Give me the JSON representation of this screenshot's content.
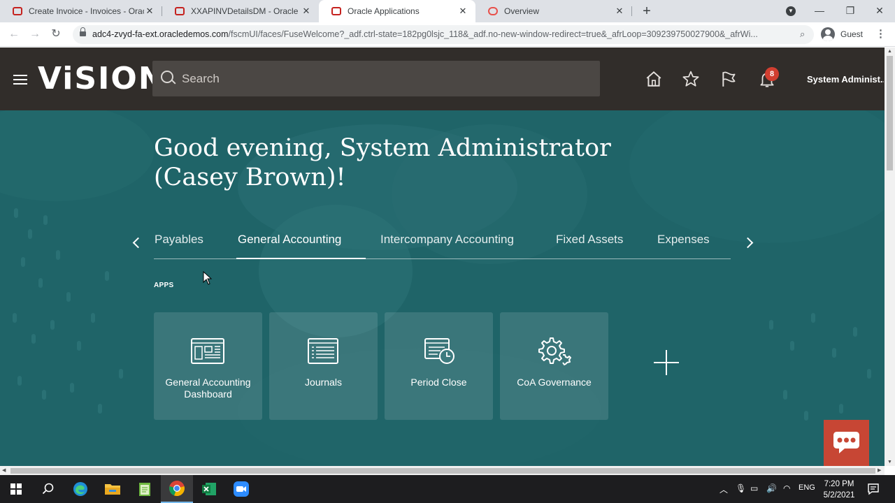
{
  "browser": {
    "tabs": [
      {
        "title": "Create Invoice - Invoices - Oracle",
        "active": false
      },
      {
        "title": "XXAPINVDetailsDM - Oracle BI P",
        "active": false
      },
      {
        "title": "Oracle Applications",
        "active": true
      },
      {
        "title": "Overview",
        "active": false
      }
    ],
    "url_host": "adc4-zvyd-fa-ext.oraclede­mos.com",
    "url_path": "/fscmUI/faces/FuseWelcome?_adf.ctrl-state=182pg0lsjc_118&_adf.no-new-window-redirect=true&_afrLoop=309239750027900&_afrWi...",
    "profile_label": "Guest"
  },
  "header": {
    "brand": "ViSION",
    "search_placeholder": "Search",
    "notification_count": "8",
    "user_name": "System Administ..."
  },
  "main": {
    "greeting": "Good evening, System Administrator (Casey Brown)!",
    "tabs": [
      {
        "label": "Payables",
        "active": false
      },
      {
        "label": "General Accounting",
        "active": true
      },
      {
        "label": "Intercompany Accounting",
        "active": false
      },
      {
        "label": "Fixed Assets",
        "active": false
      },
      {
        "label": "Expenses",
        "active": false
      }
    ],
    "apps_label": "APPS",
    "apps": [
      {
        "label": "General Accounting Dashboard",
        "icon": "dashboard-icon"
      },
      {
        "label": "Journals",
        "icon": "journals-icon"
      },
      {
        "label": "Period Close",
        "icon": "period-close-icon"
      },
      {
        "label": "CoA Governance",
        "icon": "gears-icon"
      }
    ]
  },
  "taskbar": {
    "language": "ENG",
    "time": "7:20 PM",
    "date": "5/2/2021"
  },
  "colors": {
    "header_bg": "#312d2a",
    "main_bg": "#1f6468",
    "accent": "#c74634",
    "badge": "#d23f31"
  }
}
